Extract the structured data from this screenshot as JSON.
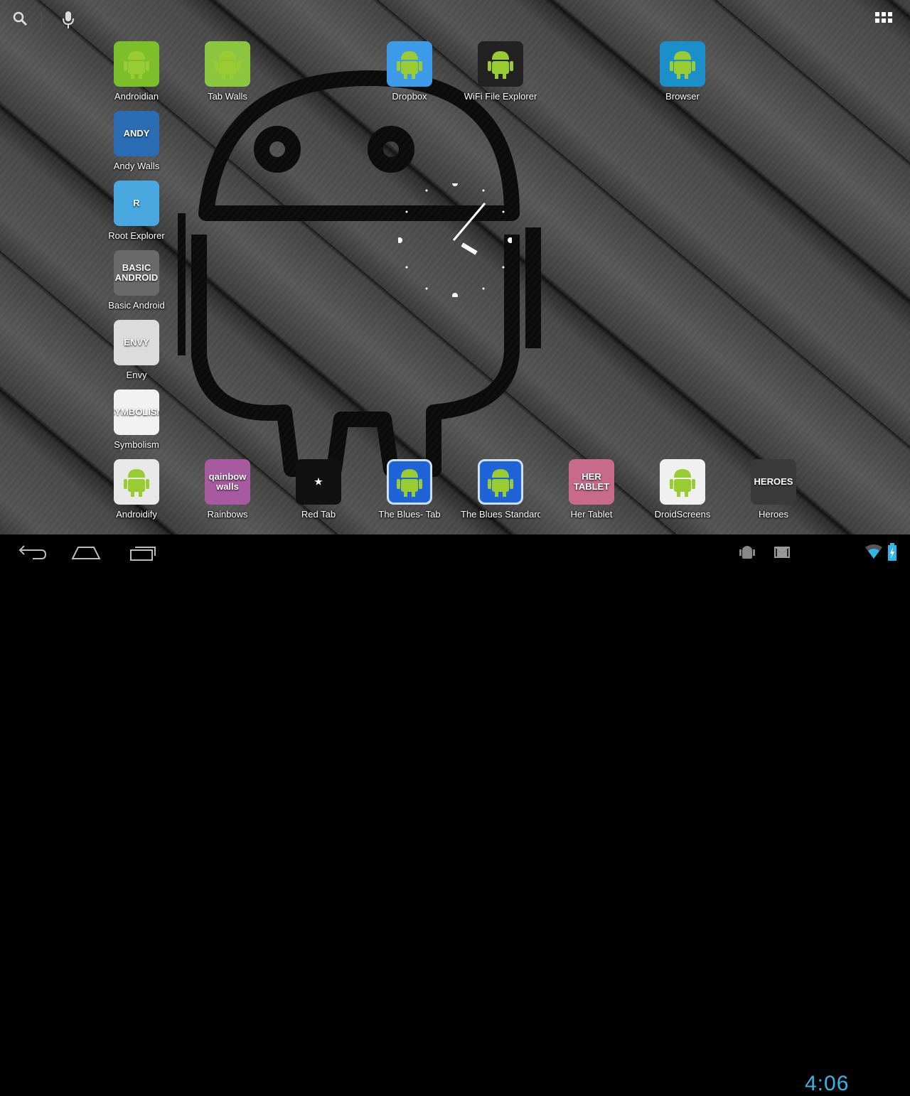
{
  "top_bar": {
    "search_icon": "search-icon",
    "voice_icon": "microphone-icon",
    "apps_icon": "all-apps-grid-icon"
  },
  "apps": [
    {
      "label": "Androidian",
      "icon_text": "",
      "color": "#7cbf2a"
    },
    {
      "label": "Tab Walls",
      "icon_text": "",
      "color": "#8cc63f"
    },
    {
      "label": "Dropbox",
      "icon_text": "",
      "color": "#3d9ae8"
    },
    {
      "label": "WiFi File Explorer",
      "icon_text": "",
      "color": "#222222"
    },
    {
      "label": "Browser",
      "icon_text": "",
      "color": "#1a8fc9"
    },
    {
      "label": "Andy Walls",
      "icon_text": "ANDY",
      "color": "#2a6db5"
    },
    {
      "label": "Root Explorer",
      "icon_text": "R",
      "color": "#4aa8e0"
    },
    {
      "label": "Basic Android",
      "icon_text": "BASIC ANDROID",
      "color": "#6a6a6a"
    },
    {
      "label": "Envy",
      "icon_text": "ENVY",
      "color": "#dcdcdc"
    },
    {
      "label": "Symbolism",
      "icon_text": "SYMBOLISM",
      "color": "#f2f2f2"
    }
  ],
  "dock": [
    {
      "label": "Androidify",
      "icon_text": "",
      "color": "#e8e8e8"
    },
    {
      "label": "Rainbows",
      "icon_text": "qainbow walls",
      "color": "#a85aa0"
    },
    {
      "label": "Red Tab",
      "icon_text": "★",
      "color": "#111111"
    },
    {
      "label": "The Blues- Tab",
      "icon_text": "",
      "color": "#1f63d8"
    },
    {
      "label": "The Blues Standard",
      "icon_text": "",
      "color": "#1f63d8"
    },
    {
      "label": "Her Tablet",
      "icon_text": "HER TABLET",
      "color": "#c86a8a"
    },
    {
      "label": "DroidScreens",
      "icon_text": "",
      "color": "#f0f0f0"
    },
    {
      "label": "Heroes",
      "icon_text": "HEROES",
      "color": "#3a3a3a"
    }
  ],
  "status": {
    "time": "4:06",
    "accent": "#33b5e5"
  }
}
